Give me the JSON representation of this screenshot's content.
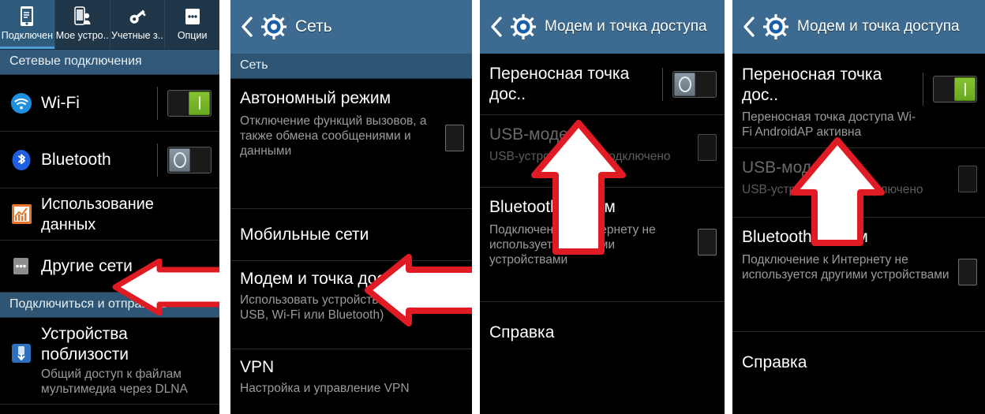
{
  "meta": {
    "device_theme": "android-samsung-touchwiz-dark",
    "accent_blue": "#3c6a90",
    "toggle_on_color": "#7bc025",
    "arrow_color": "#e01b24"
  },
  "panel1": {
    "tabs": [
      {
        "label": "Подключен",
        "icon": "connections-icon",
        "active": true
      },
      {
        "label": "Мое устро..",
        "icon": "my-device-icon",
        "active": false
      },
      {
        "label": "Учетные з..",
        "icon": "accounts-key-icon",
        "active": false
      },
      {
        "label": "Опции",
        "icon": "more-options-icon",
        "active": false
      }
    ],
    "section1": "Сетевые подключения",
    "section2": "Подключиться и отправить",
    "items": [
      {
        "title": "Wi-Fi",
        "sub": "",
        "icon": "wifi-icon",
        "toggle": "on"
      },
      {
        "title": "Bluetooth",
        "sub": "",
        "icon": "bluetooth-icon",
        "toggle": "off"
      },
      {
        "title": "Использование данных",
        "sub": "",
        "icon": "data-usage-icon",
        "toggle": "none"
      },
      {
        "title": "Другие сети",
        "sub": "",
        "icon": "more-networks-icon",
        "toggle": "none"
      }
    ],
    "items2": [
      {
        "title": "Устройства поблизости",
        "sub": "Общий доступ к файлам мультимедиа через DLNA",
        "icon": "nearby-devices-icon"
      }
    ]
  },
  "panel2": {
    "title": "Сеть",
    "back_icon": "back-chevron-icon",
    "gear_icon": "settings-gear-icon",
    "section": "Сеть",
    "items": [
      {
        "title": "Автономный режим",
        "sub": "Отключение функций вызовов, а также обмена сообщениями и данными",
        "control": "checkbox"
      },
      {
        "title": "Мобильные сети",
        "sub": "",
        "control": "none"
      },
      {
        "title": "Модем и точка доступа",
        "sub": "Использовать устройство как м (через USB, Wi-Fi или Bluetooth)",
        "control": "none"
      },
      {
        "title": "VPN",
        "sub": "Настройка и управление VPN",
        "control": "none"
      }
    ]
  },
  "panel3": {
    "title": "Модем и точка доступа",
    "back_icon": "back-chevron-icon",
    "gear_icon": "settings-gear-icon",
    "items": [
      {
        "title": "Переносная точка дос..",
        "sub": "",
        "control": "toggle",
        "toggle": "off",
        "dim": false
      },
      {
        "title": "USB-модем",
        "sub": "USB-устройство не подключено",
        "control": "checkbox",
        "dim": true
      },
      {
        "title": "Bluetooth-модем",
        "sub": "Подключение к Интернету не используется другими устройствами",
        "control": "checkbox",
        "dim": false
      },
      {
        "title": "Справка",
        "sub": "",
        "control": "none",
        "dim": false
      }
    ]
  },
  "panel4": {
    "title": "Модем и точка доступа",
    "back_icon": "back-chevron-icon",
    "gear_icon": "settings-gear-icon",
    "items": [
      {
        "title": "Переносная точка дос..",
        "sub": "Переносная точка доступа Wi-Fi AndroidAP активна",
        "control": "toggle",
        "toggle": "on",
        "dim": false
      },
      {
        "title": "USB-модем",
        "sub": "USB-устройство не подключено",
        "control": "checkbox",
        "dim": true
      },
      {
        "title": "Bluetooth-модем",
        "sub": "Подключение к Интернету не используется другими устройствами",
        "control": "checkbox",
        "dim": false
      },
      {
        "title": "Справка",
        "sub": "",
        "control": "none",
        "dim": false
      }
    ]
  },
  "annotations": {
    "arrow1": "left-pointing-arrow-other-networks",
    "arrow2": "left-pointing-arrow-tethering",
    "arrow3": "up-pointing-arrow-portable-hotspot-off",
    "arrow4": "up-pointing-arrow-portable-hotspot-on"
  }
}
